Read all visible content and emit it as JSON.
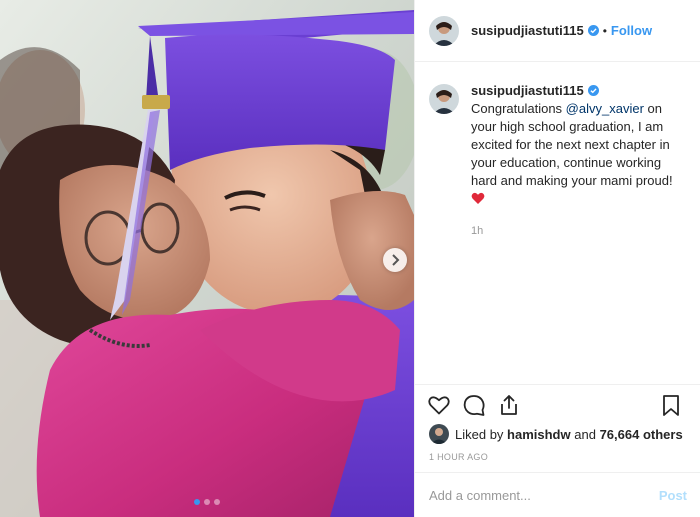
{
  "colors": {
    "accent": "#3897f0",
    "heart": "#ed4956",
    "muted": "#999999",
    "border": "#efefef"
  },
  "media": {
    "alt": "Woman in pink jacket hugging and kissing graduate in purple cap and gown",
    "cap_tassel_year": "2019",
    "carousel": {
      "count": 3,
      "active_index": 0
    }
  },
  "header": {
    "username": "susipudjiastuti115",
    "verified": true,
    "separator": "•",
    "follow_label": "Follow"
  },
  "caption": {
    "username": "susipudjiastuti115",
    "text_before_mention": " Congratulations ",
    "mention": "@alvy_xavier",
    "text_after_mention": " on your high school graduation, I am excited for the next next chapter in your education, continue working hard and making your mami proud! ",
    "emoji_icon": "red-heart-emoji",
    "time": "1h"
  },
  "actions": {
    "like_icon": "heart-outline-icon",
    "comment_icon": "comment-icon",
    "share_icon": "share-icon",
    "save_icon": "bookmark-icon"
  },
  "likes": {
    "prefix": "Liked by ",
    "user": "hamishdw",
    "middle": " and ",
    "others": "76,664 others"
  },
  "timestamp": "1 HOUR AGO",
  "add_comment": {
    "placeholder": "Add a comment...",
    "post_label": "Post"
  }
}
